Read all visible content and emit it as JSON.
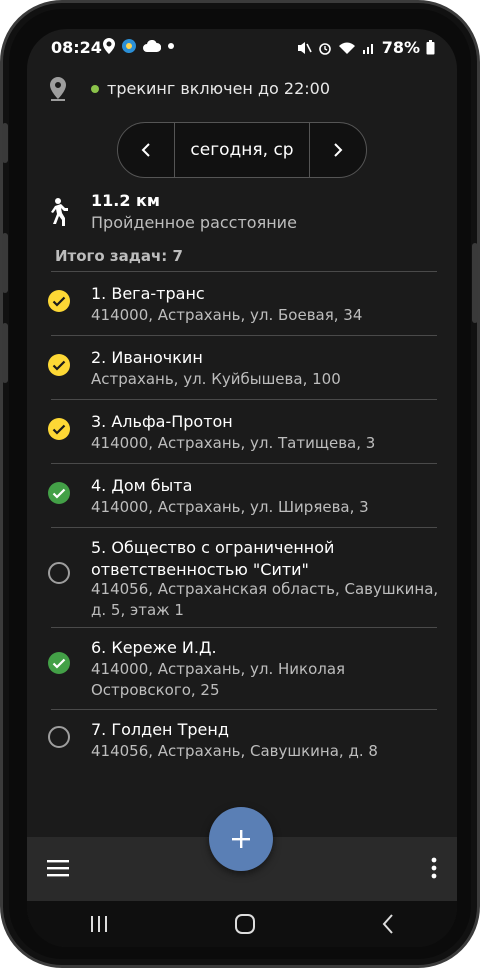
{
  "status": {
    "time": "08:24",
    "battery": "78%",
    "icons_left": [
      "location-icon",
      "globe-icon",
      "cloud-icon",
      "dot-icon"
    ],
    "icons_right": [
      "mute-icon",
      "alarm-icon",
      "wifi-icon",
      "signal-icon",
      "battery-icon"
    ]
  },
  "tracking": {
    "text": "трекинг включен до 22:00",
    "dot_color": "#8bc34a"
  },
  "date_selector": {
    "label": "сегодня, ср"
  },
  "distance": {
    "value": "11.2 км",
    "label": "Пройденное расстояние"
  },
  "tasks_total": "Итого задач: 7",
  "tasks": [
    {
      "title": "1.  Вега-транс",
      "address": "414000, Астрахань, ул. Боевая, 34",
      "status": "partial"
    },
    {
      "title": "2.  Иваночкин",
      "address": "Астрахань, ул. Куйбышева, 100",
      "status": "partial"
    },
    {
      "title": "3.  Альфа-Протон",
      "address": "414000, Астрахань, ул. Татищева, 3",
      "status": "partial"
    },
    {
      "title": "4.  Дом быта",
      "address": "414000,  Астрахань, ул. Ширяева, 3",
      "status": "done"
    },
    {
      "title": "5.  Общество с ограниченной ответственностью \"Сити\"",
      "address": "414056, Астраханская область, Савушкина, д. 5, этаж 1",
      "status": "open"
    },
    {
      "title": "6.  Кереже И.Д.",
      "address": "414000, Астрахань, ул. Николая Островского, 25",
      "status": "done"
    },
    {
      "title": "7.  Голден Тренд",
      "address": "414056, Астрахань, Савушкина, д. 8",
      "status": "open"
    }
  ],
  "colors": {
    "partial": "#fdd835",
    "done": "#43a047",
    "open": "#9e9e9e",
    "fab": "#5a7fb5"
  }
}
